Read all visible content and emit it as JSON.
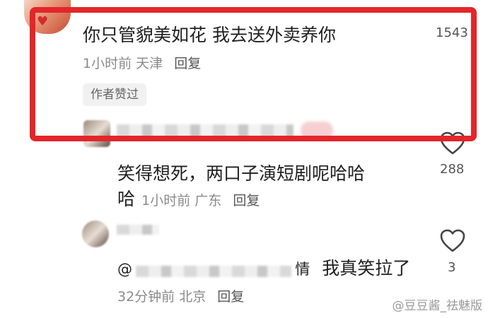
{
  "comments": [
    {
      "text": "你只管貌美如花 我去送外卖养你",
      "time": "1小时前",
      "location": "天津",
      "reply_label": "回复",
      "badge": "作者赞过",
      "likes": "1543"
    },
    {
      "text_line1": "笑得想死，两口子演短剧呢哈哈",
      "text_line2": "哈",
      "time": "1小时前",
      "location": "广东",
      "reply_label": "回复",
      "likes": "288"
    },
    {
      "mention_prefix": "@",
      "mention_suffix": "情",
      "text": "我真笑拉了",
      "time": "32分钟前",
      "location": "北京",
      "reply_label": "回复",
      "likes": "3"
    }
  ],
  "watermark": "@豆豆酱_祛魅版",
  "colors": {
    "highlight": "#e3262a",
    "muted": "#8a8a8a"
  }
}
